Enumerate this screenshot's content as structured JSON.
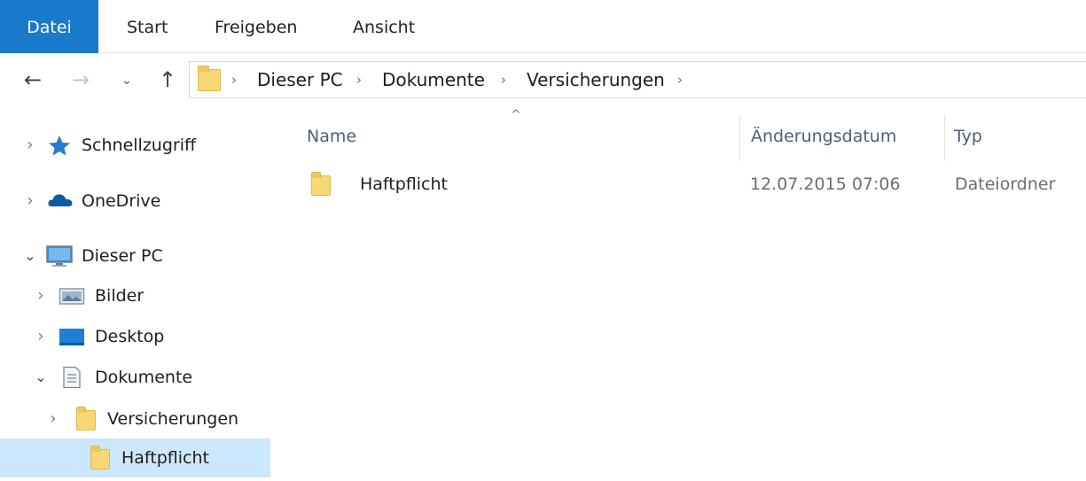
{
  "ribbon": {
    "tabs": [
      "Datei",
      "Start",
      "Freigeben",
      "Ansicht"
    ]
  },
  "nav": {
    "back_icon": "←",
    "forward_icon": "→",
    "recent_icon": "⌄",
    "up_icon": "↑",
    "breadcrumb": [
      "Dieser PC",
      "Dokumente",
      "Versicherungen"
    ],
    "separator": "›"
  },
  "sidebar": {
    "items": [
      {
        "label": "Schnellzugriff",
        "expander": "›",
        "icon": "star-icon"
      },
      {
        "label": "OneDrive",
        "expander": "›",
        "icon": "cloud-icon"
      },
      {
        "label": "Dieser PC",
        "expander": "⌄",
        "icon": "computer-icon"
      },
      {
        "label": "Bilder",
        "expander": "›",
        "icon": "pictures-icon"
      },
      {
        "label": "Desktop",
        "expander": "›",
        "icon": "desktop-icon"
      },
      {
        "label": "Dokumente",
        "expander": "⌄",
        "icon": "documents-icon"
      },
      {
        "label": "Versicherungen",
        "expander": "›",
        "icon": "folder-icon"
      },
      {
        "label": "Haftpflicht",
        "expander": "",
        "icon": "folder-icon"
      }
    ],
    "selected": "Haftpflicht"
  },
  "content": {
    "sort_indicator": "^",
    "columns": [
      "Name",
      "Änderungsdatum",
      "Typ"
    ],
    "rows": [
      {
        "name": "Haftpflicht",
        "date": "12.07.2015 07:06",
        "type": "Dateiordner"
      }
    ]
  },
  "colors": {
    "accent": "#1979ca",
    "selection": "#cce8ff",
    "folder": "#f8d775",
    "header_text": "#4c607a"
  }
}
